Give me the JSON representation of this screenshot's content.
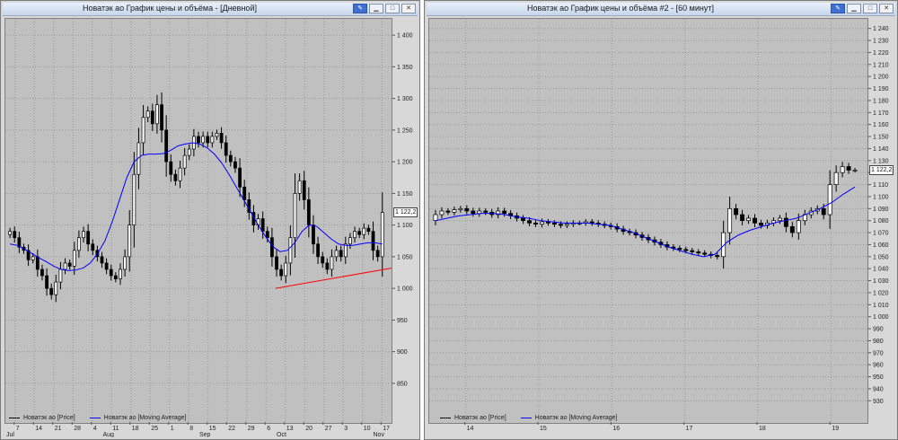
{
  "windows": [
    {
      "title": "Новатэк ао График цены и объёма - [Дневной]",
      "legend": [
        {
          "label": "Новатэк ао [Price]",
          "color": "#000000"
        },
        {
          "label": "Новатэк ао [Moving Average]",
          "color": "#0000ff"
        }
      ],
      "price_label": "1 122,2"
    },
    {
      "title": "Новатэк ао График цены и объёма #2 - [60 минут]",
      "legend": [
        {
          "label": "Новатэк ао [Price]",
          "color": "#000000"
        },
        {
          "label": "Новатэк ао [Moving Average]",
          "color": "#0000ff"
        }
      ],
      "price_label": "1 122,2"
    }
  ],
  "colors": {
    "plot_bg": "#c0c0c0",
    "ma": "#0000ff",
    "trend": "#ff0000",
    "candle_up": "#ffffff",
    "candle_down": "#000000"
  },
  "chart_data": [
    {
      "type": "candlestick",
      "interval": "Дневной",
      "x_ticks": [
        "7",
        "14",
        "21",
        "28",
        "4",
        "11",
        "18",
        "25",
        "1",
        "8",
        "15",
        "22",
        "29",
        "6",
        "13",
        "20",
        "27",
        "3",
        "10",
        "17"
      ],
      "x_months": [
        "Jul",
        "Aug",
        "Sep",
        "Oct",
        "Nov"
      ],
      "y_ticks": [
        "1 400",
        "1 350",
        "1 300",
        "1 250",
        "1 200",
        "1 150",
        "1 100",
        "1 050",
        "1 000",
        "950",
        "900",
        "850"
      ],
      "ylim": [
        830,
        1420
      ],
      "close": [
        1090,
        1080,
        1065,
        1060,
        1045,
        1050,
        1030,
        1020,
        1000,
        990,
        1010,
        1030,
        1040,
        1035,
        1060,
        1080,
        1090,
        1070,
        1060,
        1050,
        1040,
        1030,
        1020,
        1015,
        1030,
        1050,
        1100,
        1180,
        1230,
        1270,
        1280,
        1260,
        1290,
        1250,
        1200,
        1180,
        1170,
        1190,
        1210,
        1220,
        1240,
        1230,
        1240,
        1230,
        1240,
        1245,
        1230,
        1210,
        1200,
        1190,
        1160,
        1140,
        1120,
        1100,
        1110,
        1090,
        1080,
        1050,
        1030,
        1020,
        1040,
        1080,
        1150,
        1170,
        1140,
        1100,
        1070,
        1050,
        1040,
        1030,
        1050,
        1060,
        1050,
        1070,
        1080,
        1090,
        1085,
        1095,
        1090,
        1060,
        1050,
        1120
      ],
      "ma": [
        1070,
        1068,
        1062,
        1055,
        1048,
        1042,
        1035,
        1030,
        1028,
        1029,
        1032,
        1040,
        1055,
        1075,
        1105,
        1140,
        1175,
        1200,
        1210,
        1212,
        1212,
        1213,
        1218,
        1225,
        1228,
        1230,
        1228,
        1222,
        1212,
        1198,
        1180,
        1160,
        1140,
        1120,
        1100,
        1082,
        1066,
        1058,
        1060,
        1072,
        1090,
        1100,
        1098,
        1088,
        1078,
        1070,
        1068,
        1068,
        1070,
        1072,
        1072,
        1070
      ],
      "trendline": [
        {
          "x": 0.7,
          "y": 1000
        },
        {
          "x": 1.0,
          "y": 1032
        }
      ]
    },
    {
      "type": "candlestick",
      "interval": "60 минут",
      "x_ticks": [
        "14",
        "15",
        "16",
        "17",
        "18",
        "19"
      ],
      "y_ticks": [
        "1 240",
        "1 230",
        "1 220",
        "1 210",
        "1 200",
        "1 190",
        "1 180",
        "1 170",
        "1 160",
        "1 150",
        "1 140",
        "1 130",
        "1 120",
        "1 110",
        "1 100",
        "1 090",
        "1 080",
        "1 070",
        "1 060",
        "1 050",
        "1 040",
        "1 030",
        "1 020",
        "1 010",
        "1 000",
        "990",
        "980",
        "970",
        "960",
        "950",
        "940",
        "930"
      ],
      "ylim": [
        925,
        1245
      ],
      "close": [
        1085,
        1088,
        1087,
        1089,
        1090,
        1088,
        1086,
        1088,
        1087,
        1085,
        1088,
        1086,
        1084,
        1082,
        1080,
        1078,
        1077,
        1079,
        1078,
        1077,
        1076,
        1077,
        1078,
        1078,
        1079,
        1078,
        1077,
        1076,
        1075,
        1073,
        1071,
        1070,
        1068,
        1066,
        1064,
        1062,
        1060,
        1058,
        1057,
        1056,
        1055,
        1054,
        1053,
        1052,
        1051,
        1050,
        1070,
        1090,
        1085,
        1080,
        1082,
        1078,
        1076,
        1078,
        1080,
        1082,
        1075,
        1070,
        1080,
        1085,
        1088,
        1090,
        1085,
        1110,
        1120,
        1125,
        1122,
        1122
      ],
      "ma": [
        1080,
        1082,
        1084,
        1085,
        1086,
        1086,
        1085,
        1083,
        1082,
        1080,
        1079,
        1078,
        1078,
        1078,
        1077,
        1076,
        1073,
        1070,
        1066,
        1062,
        1058,
        1055,
        1052,
        1050,
        1052,
        1062,
        1068,
        1072,
        1075,
        1078,
        1080,
        1082,
        1086,
        1090,
        1095,
        1102,
        1108
      ]
    }
  ]
}
